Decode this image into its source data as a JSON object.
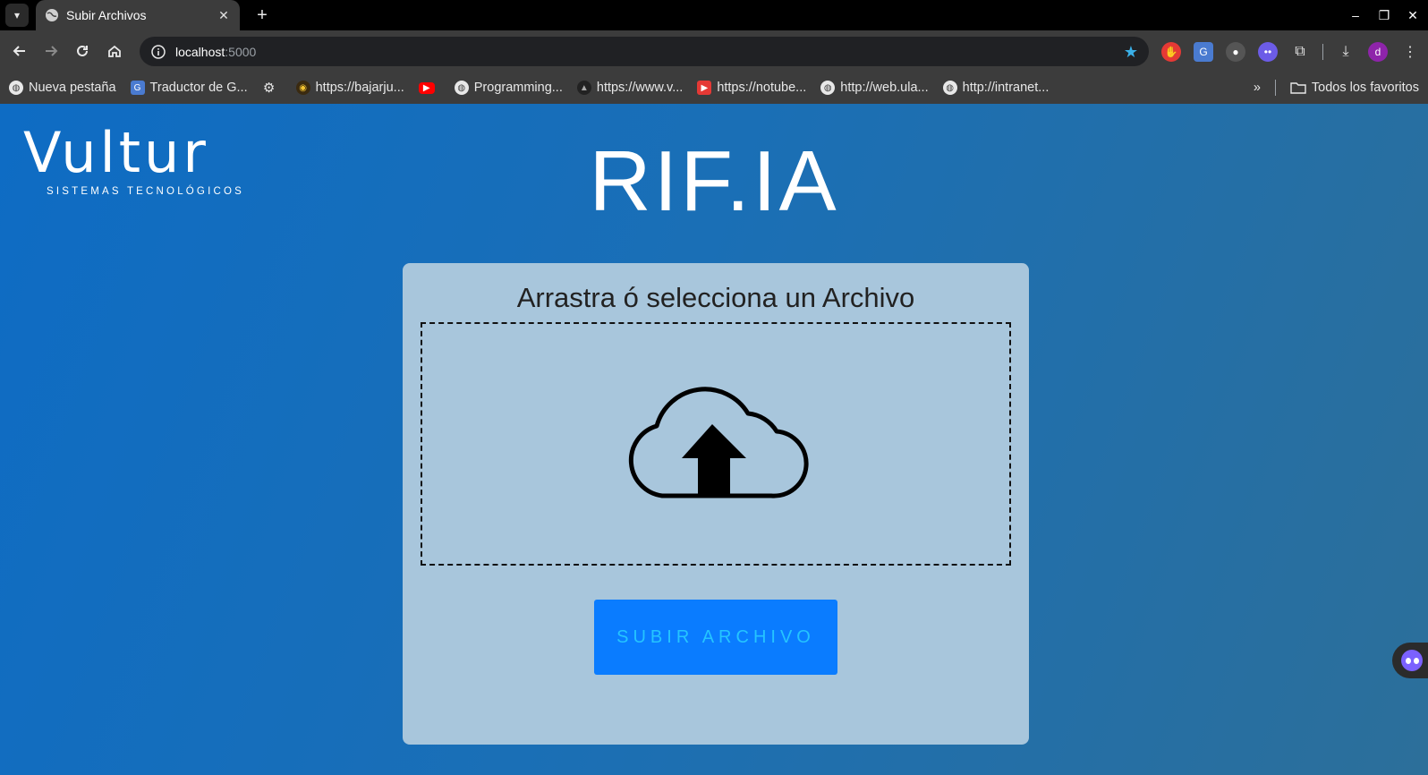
{
  "browser": {
    "tab_title": "Subir Archivos",
    "tab_close": "✕",
    "new_tab": "+",
    "url_host": "localhost",
    "url_port": ":5000",
    "profile_initial": "d"
  },
  "bookmarks": [
    {
      "label": "Nueva pestaña",
      "icon": "globe-icon"
    },
    {
      "label": "Traductor de G...",
      "icon": "translate-icon"
    },
    {
      "label": "",
      "icon": "gear-icon"
    },
    {
      "label": "https://bajarju...",
      "icon": "site-icon"
    },
    {
      "label": "",
      "icon": "youtube-icon"
    },
    {
      "label": "Programming...",
      "icon": "globe-icon"
    },
    {
      "label": "https://www.v...",
      "icon": "site-icon"
    },
    {
      "label": "https://notube...",
      "icon": "play-icon"
    },
    {
      "label": "http://web.ula...",
      "icon": "globe-icon"
    },
    {
      "label": "http://intranet...",
      "icon": "globe-icon"
    }
  ],
  "bookmarks_more": "»",
  "bookmarks_all": "Todos los favoritos",
  "page": {
    "logo_word": "Vultur",
    "logo_subtitle": "SISTEMAS TECNOLÓGICOS",
    "title": "RIF.IA",
    "card_title": "Arrastra ó selecciona un Archivo",
    "upload_button": "SUBIR ARCHIVO"
  },
  "colors": {
    "page_bg_start": "#0e6cc4",
    "page_bg_end": "#2c6f9a",
    "card_bg": "#a8c6dc",
    "button_bg": "#0a7cff",
    "button_text": "#25c4ff"
  }
}
